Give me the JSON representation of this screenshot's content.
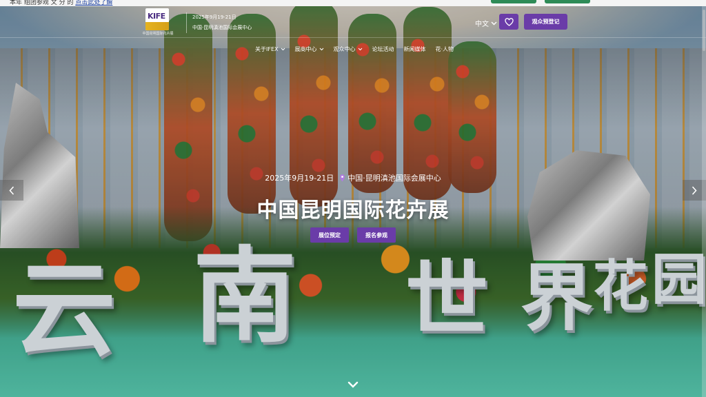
{
  "notice": {
    "text": "本年 组团参观 文 分 的",
    "link": "点击此处了解"
  },
  "header": {
    "logo_text": "KIFE",
    "logo_caption": "中国昆明国际花卉展",
    "event_date": "2025年9月19-21日",
    "event_venue": "中国·昆明滇池国际会展中心",
    "language": "中文",
    "register_button": "观众预登记"
  },
  "nav": [
    {
      "label": "关于IFEX",
      "has_dropdown": true
    },
    {
      "label": "展商中心",
      "has_dropdown": true
    },
    {
      "label": "观众中心",
      "has_dropdown": true
    },
    {
      "label": "论坛活动",
      "has_dropdown": false
    },
    {
      "label": "新闻媒体",
      "has_dropdown": false
    },
    {
      "label": "花·人物",
      "has_dropdown": false
    }
  ],
  "hero": {
    "date": "2025年9月19-21日",
    "venue": "中国·昆明滇池国际会展中心",
    "title": "中国昆明国际花卉展",
    "button_booth": "展位预定",
    "button_visit": "报名参观"
  },
  "scene_text": {
    "c1": "云",
    "c2": "南",
    "c3": "世",
    "c4": "界",
    "c5": "花",
    "c6": "园"
  },
  "colors": {
    "accent": "#6a3ca8",
    "logo_band": "#d4a017"
  },
  "icons": {
    "favorite": "heart-icon",
    "location": "location-pin-icon",
    "prev": "chevron-left-icon",
    "next": "chevron-right-icon",
    "scroll": "chevron-down-icon"
  }
}
